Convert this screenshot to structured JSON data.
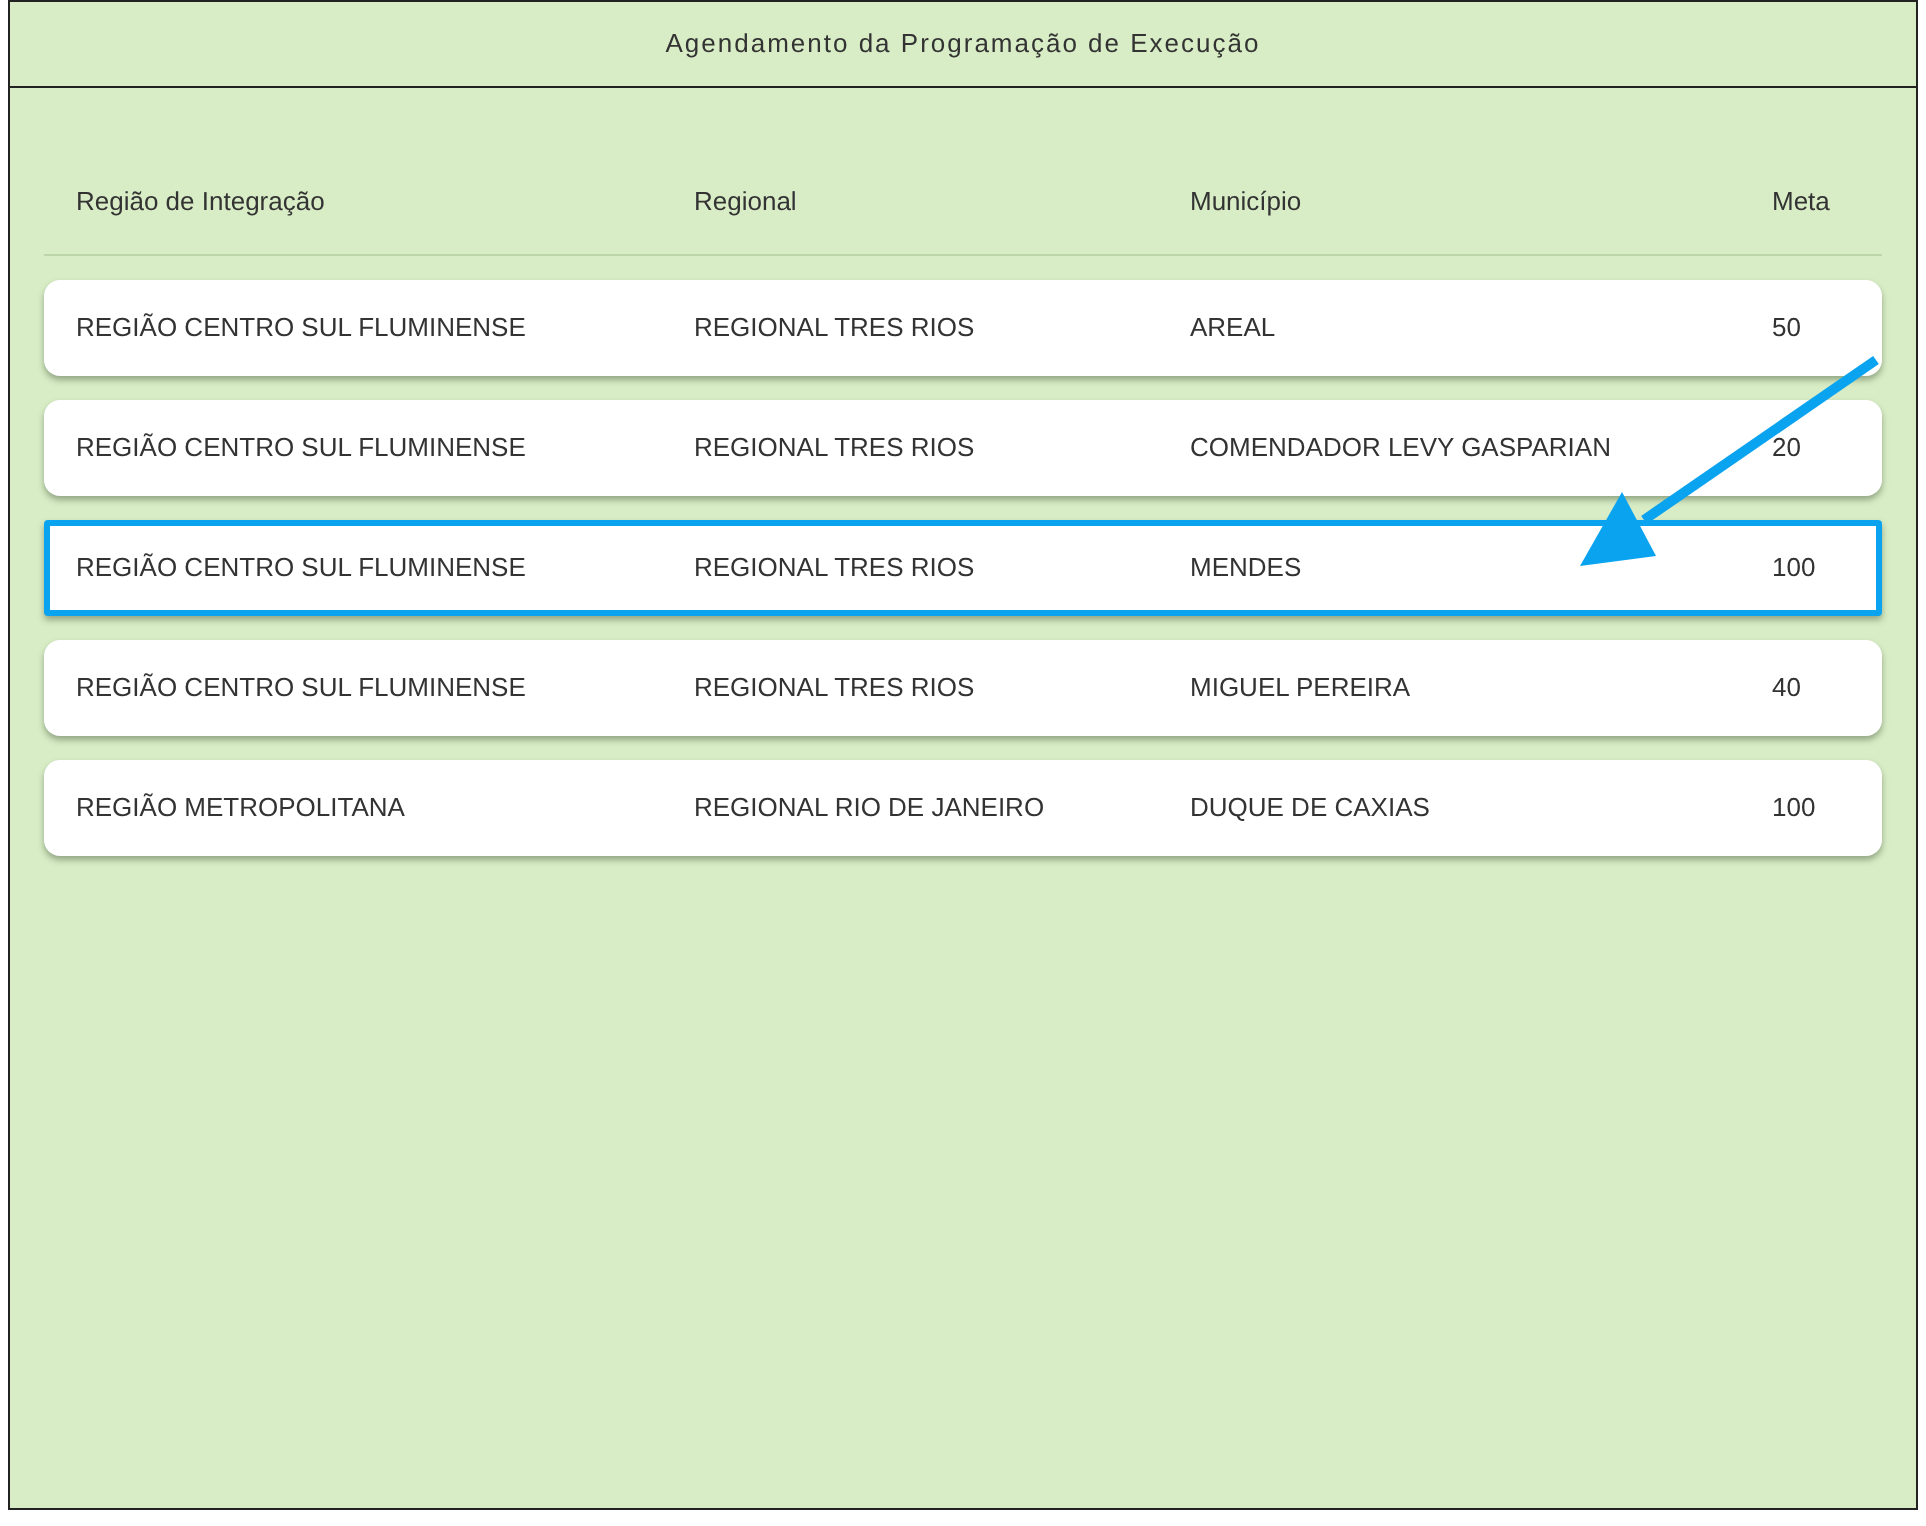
{
  "title": "Agendamento da Programação de Execução",
  "columns": [
    "Região de Integração",
    "Regional",
    "Município",
    "Meta"
  ],
  "rows": [
    {
      "cells": [
        "REGIÃO CENTRO SUL FLUMINENSE",
        "REGIONAL TRES RIOS",
        "AREAL",
        "50"
      ],
      "selected": false
    },
    {
      "cells": [
        "REGIÃO CENTRO SUL FLUMINENSE",
        "REGIONAL TRES RIOS",
        "COMENDADOR LEVY GASPARIAN",
        "20"
      ],
      "selected": false
    },
    {
      "cells": [
        "REGIÃO CENTRO SUL FLUMINENSE",
        "REGIONAL TRES RIOS",
        "MENDES",
        "100"
      ],
      "selected": true
    },
    {
      "cells": [
        "REGIÃO CENTRO SUL FLUMINENSE",
        "REGIONAL TRES RIOS",
        "MIGUEL PEREIRA",
        "40"
      ],
      "selected": false
    },
    {
      "cells": [
        "REGIÃO METROPOLITANA",
        "REGIONAL RIO DE JANEIRO",
        "DUQUE DE CAXIAS",
        "100"
      ],
      "selected": false
    }
  ]
}
